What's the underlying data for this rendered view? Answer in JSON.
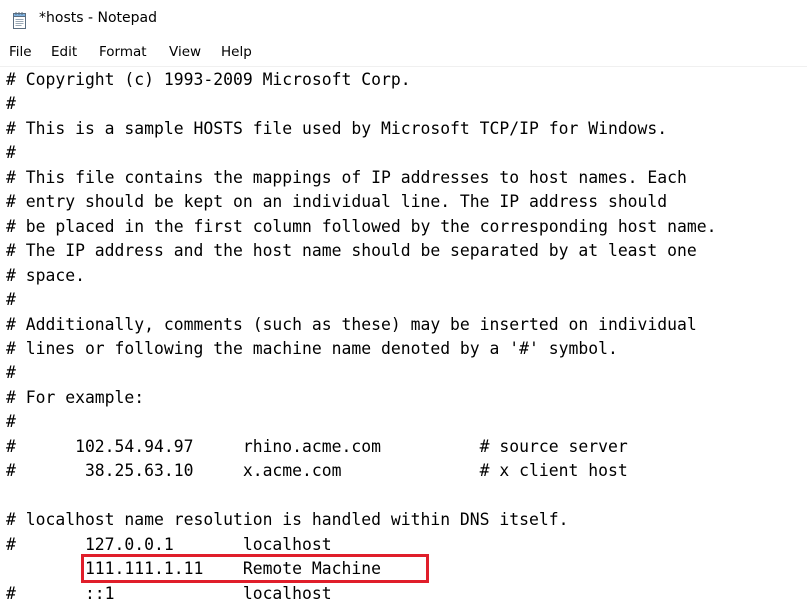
{
  "window": {
    "title": "*hosts - Notepad",
    "icon": "notepad-icon"
  },
  "menu": {
    "items": [
      "File",
      "Edit",
      "Format",
      "View",
      "Help"
    ]
  },
  "editor": {
    "lines": [
      "# Copyright (c) 1993-2009 Microsoft Corp.",
      "#",
      "# This is a sample HOSTS file used by Microsoft TCP/IP for Windows.",
      "#",
      "# This file contains the mappings of IP addresses to host names. Each",
      "# entry should be kept on an individual line. The IP address should",
      "# be placed in the first column followed by the corresponding host name.",
      "# The IP address and the host name should be separated by at least one",
      "# space.",
      "#",
      "# Additionally, comments (such as these) may be inserted on individual",
      "# lines or following the machine name denoted by a '#' symbol.",
      "#",
      "# For example:",
      "#",
      "#      102.54.94.97     rhino.acme.com          # source server",
      "#       38.25.63.10     x.acme.com              # x client host",
      "",
      "# localhost name resolution is handled within DNS itself.",
      "#       127.0.0.1       localhost",
      "        111.111.1.11    Remote Machine",
      "#       ::1             localhost"
    ],
    "highlighted_line_index": 20,
    "highlight_color": "#e01e2a"
  }
}
